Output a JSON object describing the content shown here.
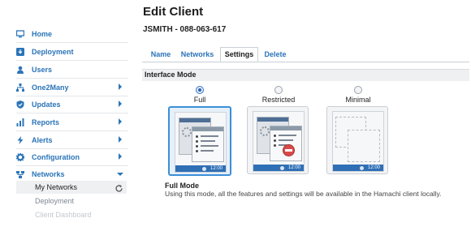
{
  "sidebar": {
    "items": [
      {
        "label": "Home",
        "icon": "monitor-icon",
        "has_caret": false
      },
      {
        "label": "Deployment",
        "icon": "download-icon",
        "has_caret": false
      },
      {
        "label": "Users",
        "icon": "user-icon",
        "has_caret": false
      },
      {
        "label": "One2Many",
        "icon": "hierarchy-icon",
        "has_caret": true
      },
      {
        "label": "Updates",
        "icon": "shield-icon",
        "has_caret": true
      },
      {
        "label": "Reports",
        "icon": "bar-chart-icon",
        "has_caret": true
      },
      {
        "label": "Alerts",
        "icon": "lightning-icon",
        "has_caret": true
      },
      {
        "label": "Configuration",
        "icon": "gear-icon",
        "has_caret": true
      },
      {
        "label": "Networks",
        "icon": "network-icon",
        "has_caret": true,
        "expanded": true
      }
    ],
    "subitems": [
      {
        "label": "My Networks",
        "active": true
      },
      {
        "label": "Deployment",
        "active": false
      },
      {
        "label": "Client Dashboard",
        "active": false
      }
    ]
  },
  "page": {
    "title": "Edit Client",
    "client": "JSMITH - 088-063-617"
  },
  "tabs": [
    {
      "label": "Name",
      "active": false
    },
    {
      "label": "Networks",
      "active": false
    },
    {
      "label": "Settings",
      "active": true
    },
    {
      "label": "Delete",
      "active": false
    }
  ],
  "interface_mode": {
    "section_title": "Interface Mode",
    "options": [
      {
        "label": "Full",
        "selected": true
      },
      {
        "label": "Restricted",
        "selected": false
      },
      {
        "label": "Minimal",
        "selected": false
      }
    ],
    "preview": {
      "app_name": "LogMeIn Hamachi",
      "clock": "12:00"
    },
    "description_title": "Full Mode",
    "description_text": "Using this mode, all the features and settings will be available in the Hamachi client locally."
  },
  "colors": {
    "accent": "#2a74b8",
    "selected_border": "#3b8fd8",
    "taskbar": "#2f6fb5"
  }
}
